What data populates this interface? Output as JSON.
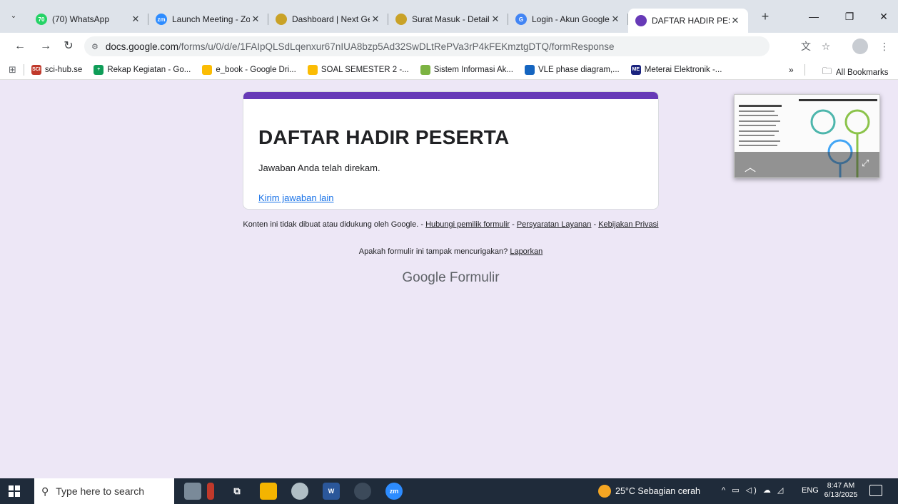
{
  "browser": {
    "tabs": [
      {
        "label": "(70) WhatsApp",
        "favicon": "whatsapp-icon",
        "color": "#25d366",
        "favtext": "70"
      },
      {
        "label": "Launch Meeting - Zo",
        "favicon": "zoom-icon",
        "color": "#2d8cff",
        "favtext": "zm"
      },
      {
        "label": "Dashboard | Next Ger",
        "favicon": "emblem-icon",
        "color": "#c9a227",
        "favtext": ""
      },
      {
        "label": "Surat Masuk - Detail",
        "favicon": "emblem-icon",
        "color": "#c9a227",
        "favtext": ""
      },
      {
        "label": "Login - Akun Google",
        "favicon": "google-icon",
        "color": "#4285f4",
        "favtext": "G"
      },
      {
        "label": "DAFTAR HADIR PESER",
        "favicon": "google-forms-icon",
        "color": "#673ab7",
        "favtext": "",
        "active": true
      }
    ],
    "url_host": "docs.google.com",
    "url_path": "/forms/u/0/d/e/1FAIpQLSdLqenxur67nIUA8bzp5Ad32SwDLtRePVa3rP4kFEKmztgDTQ/formResponse",
    "bookmarks": [
      {
        "label": "sci-hub.se",
        "color": "#c0392b",
        "icontext": "SCI"
      },
      {
        "label": "Rekap Kegiatan - Go...",
        "color": "#0f9d58",
        "icontext": "+"
      },
      {
        "label": "e_book - Google Dri...",
        "color": "#fbbc04",
        "icontext": ""
      },
      {
        "label": "SOAL SEMESTER 2 -...",
        "color": "#fbbc04",
        "icontext": ""
      },
      {
        "label": "Sistem Informasi Ak...",
        "color": "#7cb342",
        "icontext": ""
      },
      {
        "label": "VLE phase diagram,...",
        "color": "#1565c0",
        "icontext": ""
      },
      {
        "label": "Meterai Elektronik -...",
        "color": "#1a237e",
        "icontext": "ME"
      }
    ],
    "all_bookmarks_label": "All Bookmarks",
    "more_bookmarks_label": "»"
  },
  "form": {
    "title": "DAFTAR HADIR PESERTA",
    "message": "Jawaban Anda telah direkam.",
    "submit_another": "Kirim jawaban lain",
    "accent_color": "#673ab7"
  },
  "footer": {
    "disclaimer": "Konten ini tidak dibuat atau didukung oleh Google. - ",
    "contact_owner": "Hubungi pemilik formulir",
    "sep1": " - ",
    "terms": "Persyaratan Layanan",
    "sep2": " - ",
    "privacy": "Kebijakan Privasi",
    "suspicious": "Apakah formulir ini tampak mencurigakan? ",
    "report": "Laporkan",
    "brand_google": "Google",
    "brand_forms": " Formulir"
  },
  "taskbar": {
    "search_placeholder": "Type here to search",
    "weather": "25°C  Sebagian cerah",
    "language": "ENG",
    "time": "8:47 AM",
    "date": "6/13/2025"
  }
}
